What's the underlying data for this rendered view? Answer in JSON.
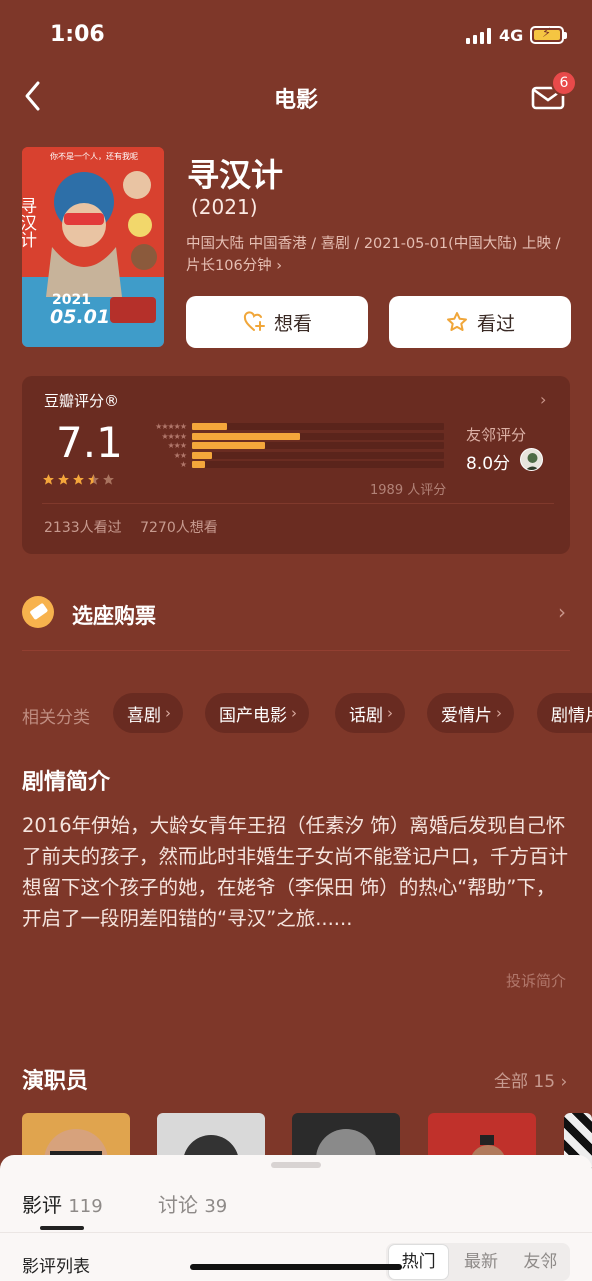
{
  "status_bar": {
    "time": "1:06",
    "network": "4G"
  },
  "nav": {
    "title": "电影",
    "notification_count": "6"
  },
  "movie": {
    "title": "寻汉计",
    "year": "(2021)",
    "meta": "中国大陆 中国香港 / 喜剧 / 2021-05-01(中国大陆) 上映 / 片长106分钟 ›",
    "poster": {
      "tagline": "你不是一个人，还有我呢",
      "title": "寻汉计",
      "date_year": "2021",
      "date": "05.01"
    },
    "want_label": "想看",
    "seen_label": "看过"
  },
  "rating": {
    "source": "豆瓣评分®",
    "score": "7.1",
    "stars": 3.5,
    "distribution": [
      0.14,
      0.43,
      0.29,
      0.08,
      0.05
    ],
    "count_text": "1989 人评分",
    "friend_label": "友邻评分",
    "friend_score": "8.0分",
    "seen_text": "2133人看过",
    "want_text": "7270人想看"
  },
  "ticket": {
    "label": "选座购票"
  },
  "categories": {
    "label": "相关分类",
    "items": [
      "喜剧",
      "国产电影",
      "话剧",
      "爱情片",
      "剧情片"
    ]
  },
  "synopsis": {
    "title": "剧情简介",
    "text": "2016年伊始，大龄女青年王招（任素汐 饰）离婚后发现自己怀了前夫的孩子，然而此时非婚生子女尚不能登记户口，千方百计想留下这个孩子的她，在姥爷（李保田 饰）的热心“帮助”下，开启了一段阴差阳错的“寻汉”之旅......",
    "report": "投诉简介"
  },
  "cast": {
    "title": "演职员",
    "all_label": "全部 15 ›"
  },
  "sheet": {
    "tabs": [
      {
        "label": "影评",
        "count": "119"
      },
      {
        "label": "讨论",
        "count": "39"
      }
    ],
    "list_title": "影评列表",
    "sort_options": [
      "热门",
      "最新",
      "友邻"
    ]
  },
  "colors": {
    "background": "#7e3729",
    "card": "#6a2c21",
    "accent": "#f4a63b",
    "badge": "#e84a4a"
  }
}
